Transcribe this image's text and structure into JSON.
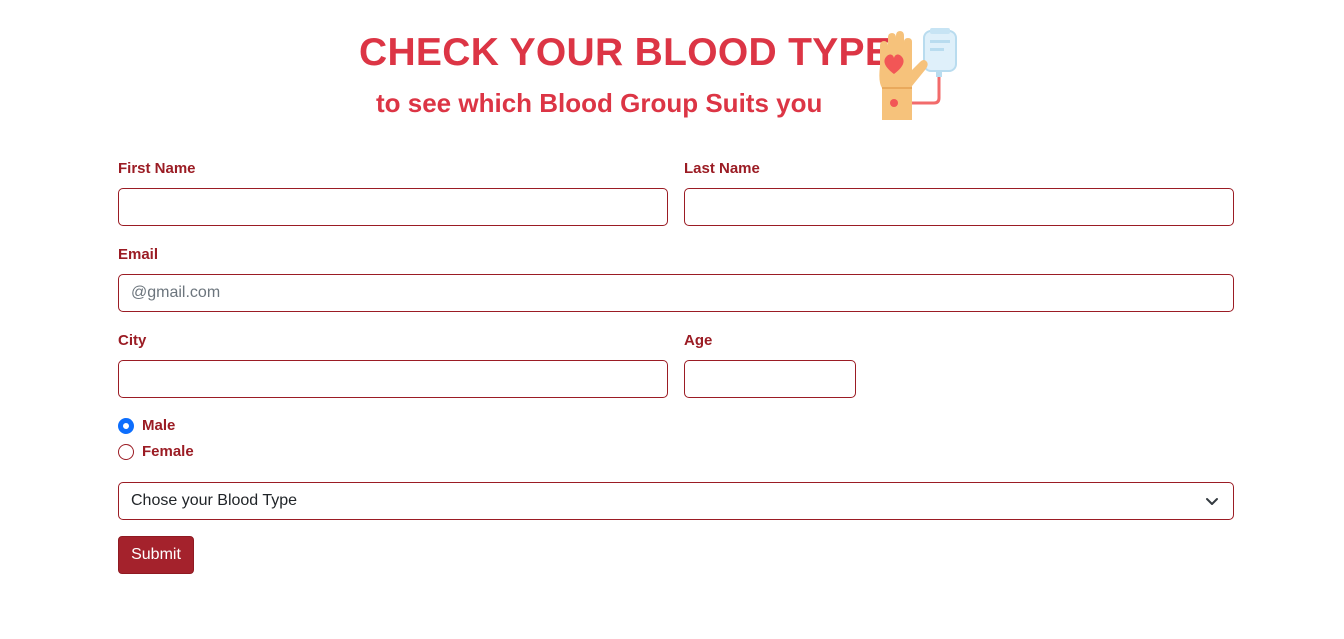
{
  "header": {
    "title": "CHECK YOUR BLOOD TYPE",
    "subtitle": "to see which Blood Group Suits you",
    "logo_icon": "blood-donation-hand-icon"
  },
  "form": {
    "first_name": {
      "label": "First Name",
      "value": "",
      "placeholder": ""
    },
    "last_name": {
      "label": "Last Name",
      "value": "",
      "placeholder": ""
    },
    "email": {
      "label": "Email",
      "value": "",
      "placeholder": "@gmail.com"
    },
    "city": {
      "label": "City",
      "value": "",
      "placeholder": ""
    },
    "age": {
      "label": "Age",
      "value": "",
      "placeholder": ""
    },
    "gender": {
      "options": [
        {
          "label": "Male",
          "checked": true
        },
        {
          "label": "Female",
          "checked": false
        }
      ]
    },
    "blood_type": {
      "selected": "Chose your Blood Type"
    },
    "submit_label": "Submit"
  },
  "colors": {
    "title": "#dc3545",
    "label": "#9b1c24",
    "border": "#9b1c24",
    "button": "#a4222c",
    "radio_checked": "#0d6efd"
  }
}
